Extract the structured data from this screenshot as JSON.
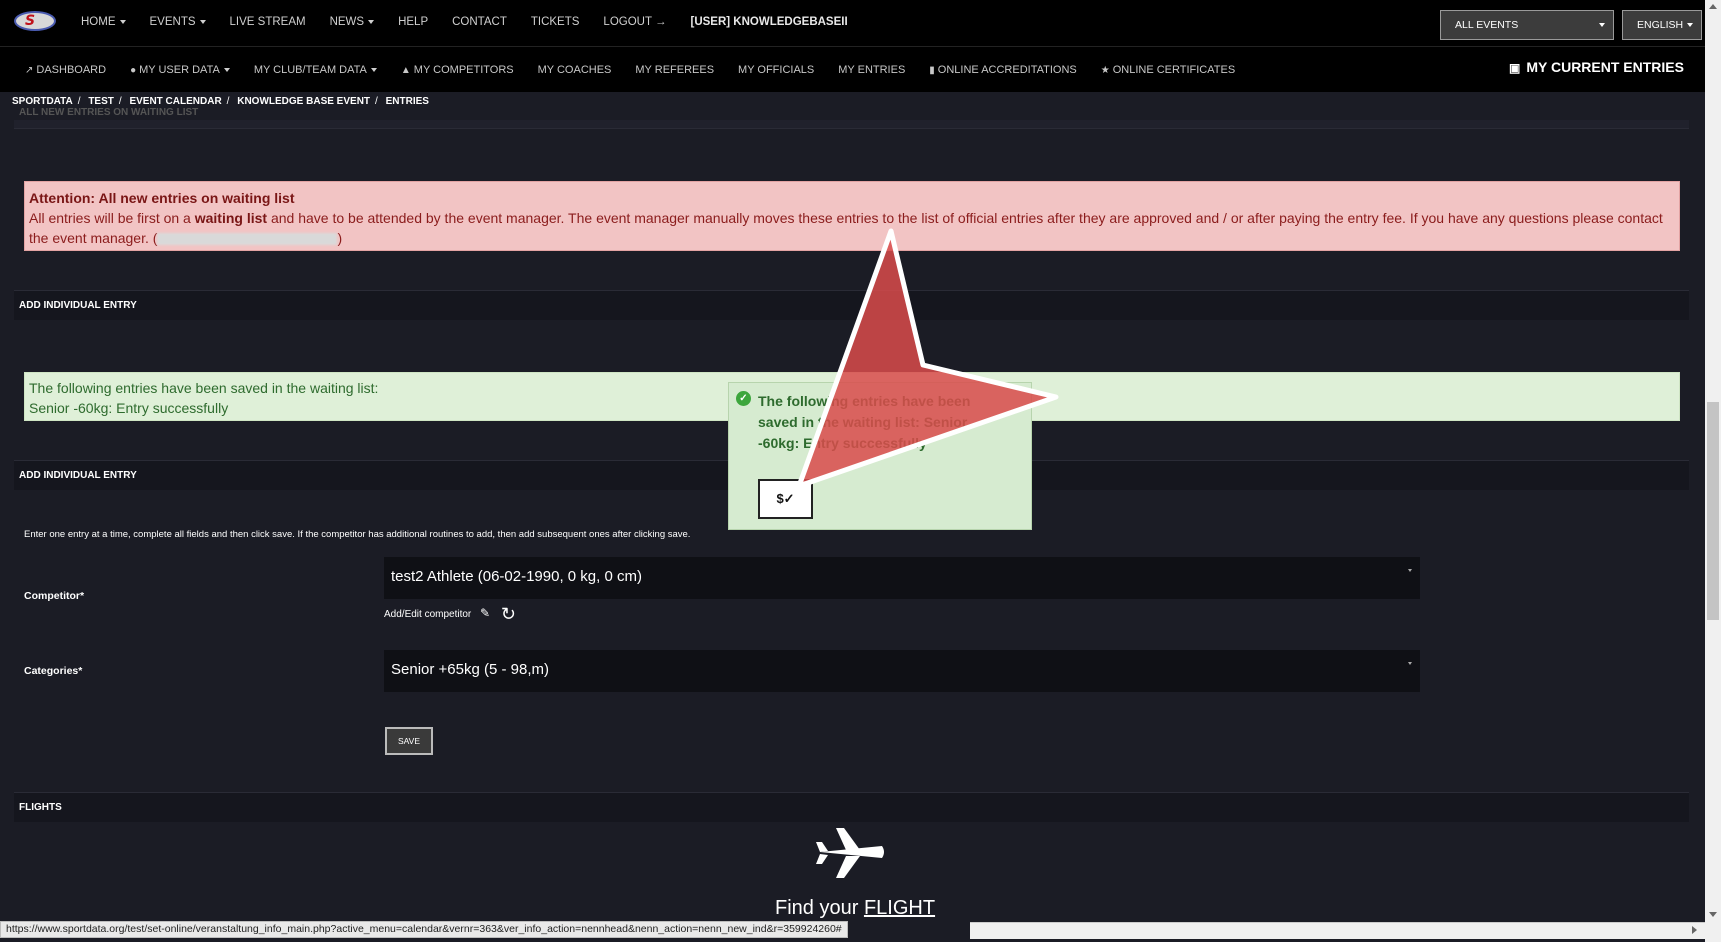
{
  "topnav": {
    "logo_text": "S",
    "items": [
      "HOME",
      "EVENTS",
      "LIVE STREAM",
      "NEWS",
      "HELP",
      "CONTACT",
      "TICKETS",
      "LOGOUT"
    ],
    "user": "[USER] KNOWLEDGEBASEII",
    "events_select": "ALL EVENTS",
    "language_select": "ENGLISH"
  },
  "subnav": {
    "items": [
      "DASHBOARD",
      "MY USER DATA",
      "MY CLUB/TEAM DATA",
      "MY COMPETITORS",
      "MY COACHES",
      "MY REFEREES",
      "MY OFFICIALS",
      "MY ENTRIES",
      "ONLINE ACCREDITATIONS",
      "ONLINE CERTIFICATES"
    ],
    "current_entries": "MY CURRENT ENTRIES"
  },
  "breadcrumb": [
    "SPORTDATA",
    "TEST",
    "EVENT CALENDAR",
    "KNOWLEDGE BASE EVENT",
    "ENTRIES"
  ],
  "ghost_header": "ALL NEW ENTRIES ON WAITING LIST",
  "attention": {
    "title": "Attention: All new entries on waiting list",
    "text_before": "All entries will be first on a",
    "bold": "waiting list",
    "text_after": "and have to be attended by the event manager. The event manager manually moves these entries to the list of official entries after they are approved and / or after paying the entry fee. If you have any questions please contact the event manager.",
    "open_paren": "(",
    "close_paren": ")"
  },
  "panels": {
    "add_individual_entry": "ADD INDIVIDUAL ENTRY",
    "flights": "FLIGHTS"
  },
  "success": {
    "line1": "The following entries have been saved in the waiting list:",
    "line2": "Senior -60kg: Entry successfully"
  },
  "form": {
    "hint": "Enter one entry at a time, complete all fields and then click save. If the competitor has additional routines to add, then add subsequent ones after clicking save.",
    "competitor_label": "Competitor*",
    "competitor_value": "test2 Athlete (06-02-1990, 0 kg, 0 cm)",
    "add_edit_label": "Add/Edit competitor",
    "categories_label": "Categories*",
    "categories_value": "Senior +65kg (5 - 98,m)",
    "save_label": "SAVE"
  },
  "flight": {
    "find_text": "Find your",
    "find_link": "FLIGHT"
  },
  "popup": {
    "message": "The following entries have been saved in the waiting list: Senior -60kg: Entry successfully",
    "button_label": "$✓"
  },
  "status_url": "https://www.sportdata.org/test/set-online/veranstaltung_info_main.php?active_menu=calendar&vernr=363&ver_info_action=nennhead&nenn_action=nenn_new_ind&r=359924260#",
  "colors": {
    "page_bg": "#1b1c25",
    "navbar_bg": "#000000",
    "alert_red_bg": "#f2c4c4",
    "alert_green_bg": "#dff0d8",
    "pointer_red": "#d94b4b"
  }
}
